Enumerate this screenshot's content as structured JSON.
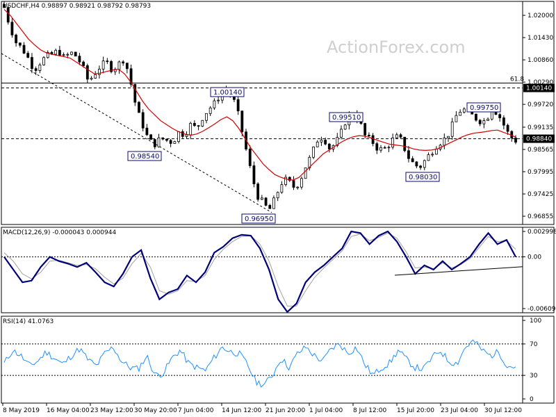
{
  "header": {
    "price_title": "USDCHF,H4  0.98897 0.98921 0.98792 0.98793",
    "macd_title": "MACD(12,26,9) -0.000043 0.000944",
    "rsi_title": "RSI(14) 41.0763"
  },
  "watermark": "ActionForex.com",
  "colors": {
    "candle": "#000000",
    "ma": "#d40000",
    "macd_line": "#00007a",
    "signal_line": "#a0a0a0",
    "rsi_line": "#1e90ff",
    "label_box": "#0a0a70",
    "level_line": "#000000"
  },
  "chart_data": [
    {
      "type": "candlestick",
      "title": "USDCHF,H4",
      "ylim": [
        0.9675,
        1.0225
      ],
      "y_ticks": [
        "1.02000",
        "1.01430",
        "1.00860",
        "1.00290",
        "0.99720",
        "0.99135",
        "0.98565",
        "0.97995",
        "0.97425",
        "0.96855"
      ],
      "x_ticks": [
        "8 May 2019",
        "16 May 04:00",
        "23 May 12:00",
        "30 May 20:00",
        "7 Jun 04:00",
        "14 Jun 12:00",
        "21 Jun 20:00",
        "1 Jul 04:00",
        "8 Jul 12:00",
        "15 Jul 20:00",
        "23 Jul 04:00",
        "30 Jul 12:00"
      ],
      "close_path": [
        1.022,
        1.017,
        1.013,
        1.0115,
        1.009,
        1.006,
        1.008,
        1.0095,
        1.01,
        1.011,
        1.009,
        1.0105,
        1.0095,
        1.007,
        1.003,
        1.005,
        1.007,
        1.008,
        1.006,
        1.0075,
        1.009,
        1.003,
        0.996,
        0.992,
        0.988,
        0.987,
        0.9885,
        0.988,
        0.9875,
        0.99,
        0.9895,
        0.992,
        0.991,
        0.994,
        0.996,
        0.9975,
        1.0,
        1.001,
        0.999,
        0.994,
        0.987,
        0.98,
        0.974,
        0.972,
        0.97,
        0.973,
        0.977,
        0.978,
        0.976,
        0.977,
        0.981,
        0.984,
        0.988,
        0.989,
        0.986,
        0.987,
        0.99,
        0.994,
        0.995,
        0.993,
        0.989,
        0.988,
        0.986,
        0.9855,
        0.987,
        0.989,
        0.988,
        0.984,
        0.982,
        0.981,
        0.983,
        0.985,
        0.987,
        0.988,
        0.99,
        0.994,
        0.996,
        0.9955,
        0.994,
        0.993,
        0.993,
        0.996,
        0.995,
        0.992,
        0.989,
        0.98793
      ],
      "ma_path": [
        1.0215,
        1.02,
        1.018,
        1.016,
        1.014,
        1.0125,
        1.0112,
        1.0104,
        1.01,
        1.0097,
        1.0094,
        1.009,
        1.008,
        1.007,
        1.006,
        1.005,
        1.0052,
        1.0056,
        1.006,
        1.0062,
        1.005,
        1.003,
        1.0005,
        0.998,
        0.996,
        0.9945,
        0.993,
        0.992,
        0.991,
        0.9902,
        0.9896,
        0.9893,
        0.9896,
        0.9903,
        0.9912,
        0.9922,
        0.9933,
        0.994,
        0.993,
        0.991,
        0.9885,
        0.986,
        0.984,
        0.982,
        0.9805,
        0.9792,
        0.9785,
        0.978,
        0.9778,
        0.9785,
        0.98,
        0.9815,
        0.983,
        0.9845,
        0.9855,
        0.9865,
        0.9875,
        0.9883,
        0.9889,
        0.9892,
        0.989,
        0.9886,
        0.988,
        0.9875,
        0.987,
        0.9868,
        0.9866,
        0.9863,
        0.9858,
        0.9855,
        0.9854,
        0.9855,
        0.9858,
        0.9865,
        0.9873,
        0.988,
        0.9888,
        0.9894,
        0.9898,
        0.99,
        0.9902,
        0.9905,
        0.9906,
        0.99,
        0.9895,
        0.9888
      ],
      "horizontal_lines": [
        {
          "label": "61.8",
          "value": 1.0014,
          "style": "solid"
        },
        {
          "value": 1.0014,
          "style": "dashed"
        },
        {
          "value": 0.9884,
          "style": "dashed"
        }
      ],
      "current_price_tags": [
        "1.00140",
        "0.98840"
      ],
      "annotations": [
        "1.00140",
        "0.99510",
        "0.99750",
        "0.98540",
        "0.98030",
        "0.96950"
      ],
      "trendline": [
        1.012,
        0.9695
      ]
    },
    {
      "type": "line",
      "title": "MACD(12,26,9)",
      "ylim": [
        -0.006097,
        0.002998
      ],
      "y_ticks": [
        "0.002998",
        "0.00",
        "-0.006097"
      ],
      "series": [
        {
          "name": "MACD",
          "values": [
            0.0,
            -0.0015,
            -0.003,
            -0.0028,
            -0.0012,
            0.0,
            -0.0005,
            -0.0008,
            -0.0012,
            -0.0007,
            -0.0018,
            -0.003,
            -0.0035,
            -0.002,
            0.0,
            0.0008,
            -0.0025,
            -0.005,
            -0.0042,
            -0.0038,
            -0.0022,
            -0.003,
            -0.0018,
            0.0005,
            0.0012,
            0.0022,
            0.0026,
            0.0025,
            0.001,
            -0.0015,
            -0.005,
            -0.0065,
            -0.0055,
            -0.003,
            -0.0018,
            -0.001,
            0.0,
            0.001,
            0.003,
            0.0028,
            0.0015,
            0.0025,
            0.003,
            0.0018,
            0.0,
            -0.002,
            -0.001,
            -0.0015,
            -0.0005,
            -0.0015,
            -0.0008,
            0.0,
            0.0015,
            0.0028,
            0.0015,
            0.002,
            0.0
          ]
        },
        {
          "name": "Signal",
          "values": [
            0.0005,
            -0.0005,
            -0.002,
            -0.0026,
            -0.0018,
            -0.0005,
            -0.0004,
            -0.0007,
            -0.001,
            -0.0009,
            -0.0014,
            -0.0024,
            -0.0032,
            -0.0025,
            -0.0008,
            0.0004,
            -0.0012,
            -0.004,
            -0.0044,
            -0.004,
            -0.0028,
            -0.0029,
            -0.0022,
            -0.0003,
            0.0009,
            0.0018,
            0.0024,
            0.0025,
            0.0015,
            -0.0005,
            -0.0035,
            -0.0058,
            -0.0058,
            -0.004,
            -0.0024,
            -0.0013,
            -0.0003,
            0.0007,
            0.0024,
            0.0027,
            0.0019,
            0.0023,
            0.0028,
            0.0022,
            0.0006,
            -0.0013,
            -0.0012,
            -0.0014,
            -0.0007,
            -0.0013,
            -0.0009,
            -0.0002,
            0.0011,
            0.0024,
            0.0018,
            0.0019,
            0.0009
          ]
        }
      ],
      "trendline": [
        -0.002,
        -0.001
      ]
    },
    {
      "type": "line",
      "title": "RSI(14)",
      "ylim": [
        0,
        100
      ],
      "y_ticks": [
        "100",
        "70",
        "30",
        "0"
      ],
      "levels": [
        70,
        30
      ],
      "series": [
        {
          "name": "RSI",
          "values": [
            45,
            62,
            55,
            42,
            48,
            60,
            52,
            44,
            55,
            64,
            50,
            42,
            58,
            66,
            48,
            40,
            38,
            55,
            30,
            33,
            52,
            62,
            45,
            40,
            36,
            52,
            66,
            60,
            58,
            44,
            22,
            18,
            30,
            52,
            40,
            58,
            66,
            55,
            48,
            64,
            70,
            58,
            66,
            44,
            30,
            40,
            46,
            62,
            50,
            40,
            38,
            52,
            62,
            48,
            45,
            66,
            74,
            62,
            55,
            60,
            42,
            41
          ]
        }
      ]
    }
  ]
}
